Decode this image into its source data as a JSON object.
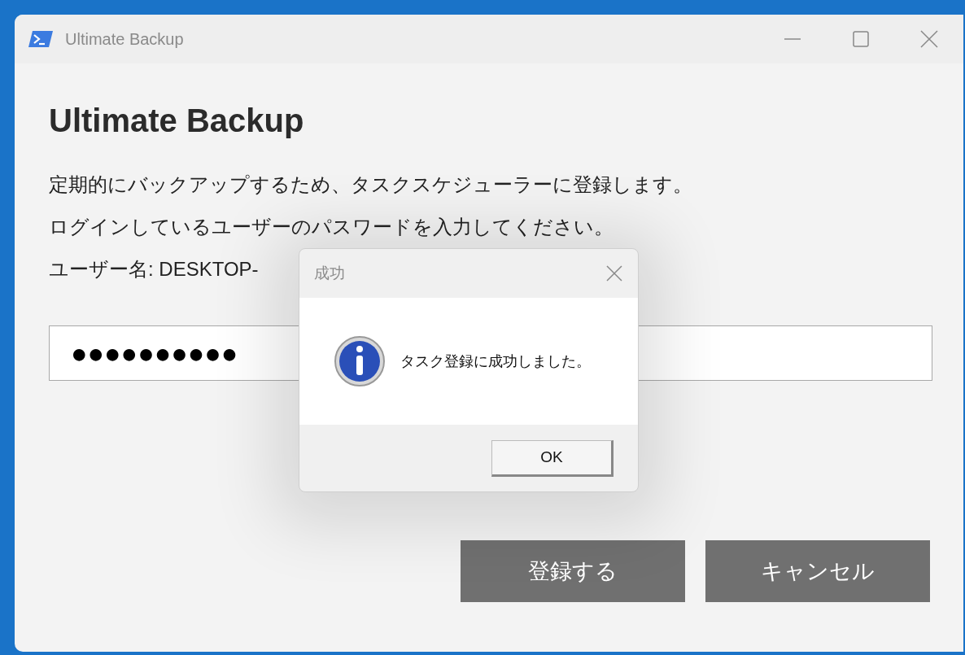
{
  "window": {
    "title": "Ultimate Backup"
  },
  "heading": "Ultimate Backup",
  "lines": [
    "定期的にバックアップするため、タスクスケジューラーに登録します。",
    "ログインしているユーザーのパスワードを入力してください。",
    "ユーザー名: DESKTOP-"
  ],
  "password": {
    "value": "●●●●●●●●●●"
  },
  "buttons": [
    "登録する",
    "キャンセル"
  ],
  "dialog": {
    "title": "成功",
    "message": "タスク登録に成功しました。",
    "buttons": [
      "OK"
    ]
  }
}
